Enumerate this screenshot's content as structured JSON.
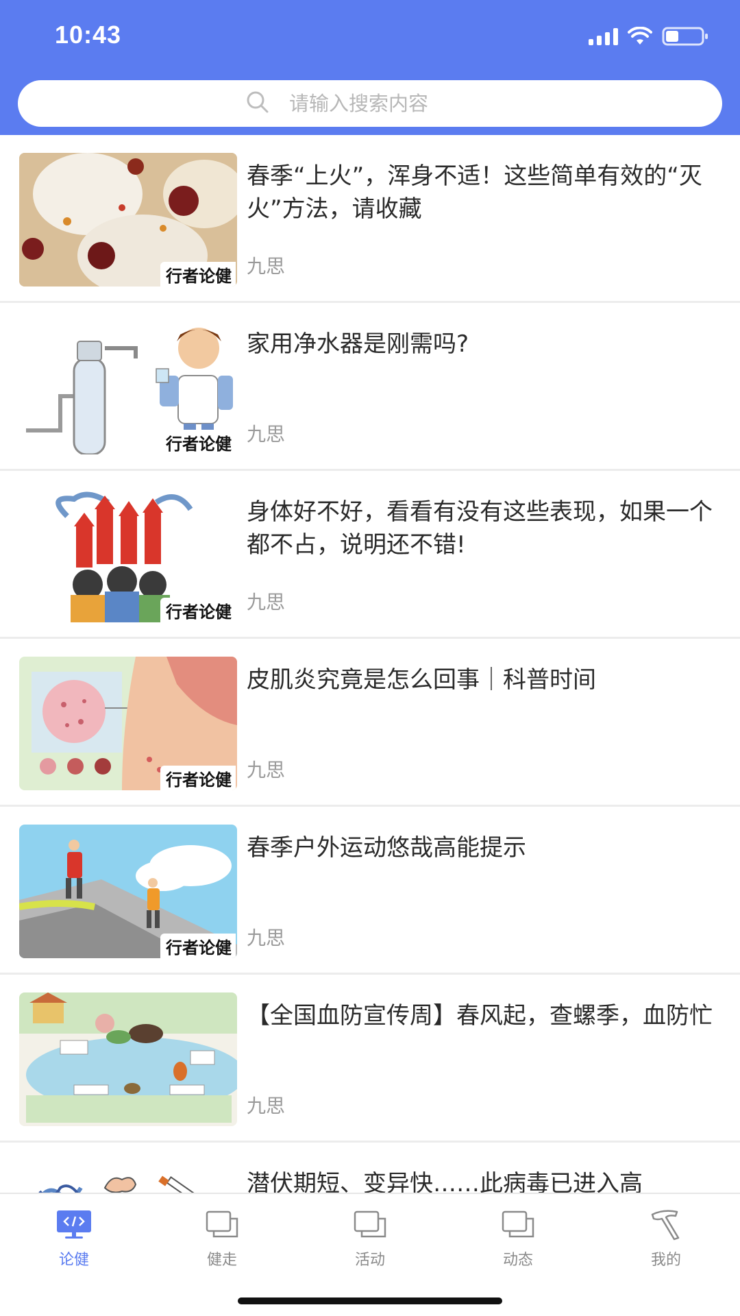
{
  "status_bar": {
    "time": "10:43"
  },
  "search": {
    "placeholder": "请输入搜索内容"
  },
  "articles": [
    {
      "title": "春季“上火”，浑身不适！这些简单有效的“灭火”方法，请收藏",
      "author": "九思",
      "brand": "行者论健"
    },
    {
      "title": "家用净水器是刚需吗?",
      "author": "九思",
      "brand": "行者论健"
    },
    {
      "title": "身体好不好，看看有没有这些表现，如果一个都不占，说明还不错!",
      "author": "九思",
      "brand": "行者论健"
    },
    {
      "title": "皮肌炎究竟是怎么回事｜科普时间",
      "author": "九思",
      "brand": "行者论健"
    },
    {
      "title": "春季户外运动悠哉高能提示",
      "author": "九思",
      "brand": "行者论健"
    },
    {
      "title": "【全国血防宣传周】春风起，查螺季，血防忙",
      "author": "九思",
      "brand": ""
    },
    {
      "title": "潜伏期短、变异快……此病毒已进入高",
      "author": "",
      "brand": ""
    }
  ],
  "tabs": [
    {
      "label": "论健",
      "icon": "code-monitor-icon",
      "active": true
    },
    {
      "label": "健走",
      "icon": "layers-icon",
      "active": false
    },
    {
      "label": "活动",
      "icon": "layers-icon",
      "active": false
    },
    {
      "label": "动态",
      "icon": "layers-icon",
      "active": false
    },
    {
      "label": "我的",
      "icon": "hammer-icon",
      "active": false
    }
  ],
  "colors": {
    "accent": "#5b7cf0",
    "text": "#2a2a2a",
    "muted": "#9a9a9a"
  }
}
